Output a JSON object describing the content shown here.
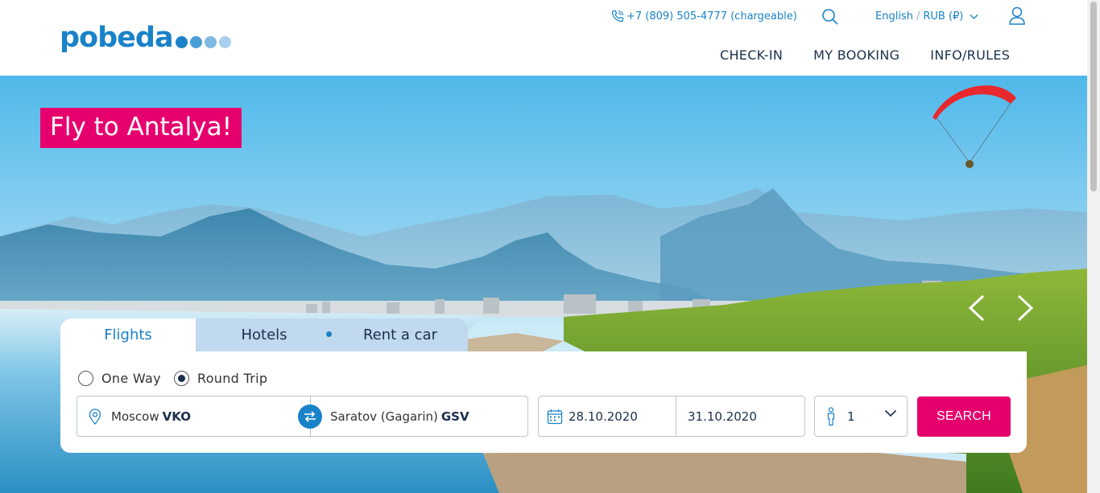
{
  "header": {
    "logo_text": "pobeda",
    "logo_dot_colors": [
      "#1a82c8",
      "#4a9dd6",
      "#7fb8e2",
      "#a9cfee"
    ],
    "phone": "+7 (809) 505-4777 (chargeable)",
    "language": "English",
    "currency": "RUB (₽)",
    "lang_separator": "/"
  },
  "nav": {
    "items": [
      {
        "label": "CHECK-IN"
      },
      {
        "label": "MY BOOKING"
      },
      {
        "label": "INFO/RULES"
      }
    ]
  },
  "hero": {
    "promo_text": "Fly to Antalya!"
  },
  "search": {
    "tabs": [
      {
        "label": "Flights",
        "active": true
      },
      {
        "label": "Hotels",
        "active": false
      },
      {
        "label": "Rent a car",
        "active": false
      }
    ],
    "trip_types": [
      {
        "label": "One Way",
        "selected": false
      },
      {
        "label": "Round Trip",
        "selected": true
      }
    ],
    "from": {
      "city": "Moscow",
      "code": "VKO"
    },
    "to": {
      "city": "Saratov (Gagarin)",
      "code": "GSV"
    },
    "depart_date": "28.10.2020",
    "return_date": "31.10.2020",
    "passengers": "1",
    "search_label": "SEARCH"
  },
  "colors": {
    "brand_blue": "#1a82c8",
    "accent_pink": "#e6006e",
    "dark_navy": "#1a2f4b"
  }
}
